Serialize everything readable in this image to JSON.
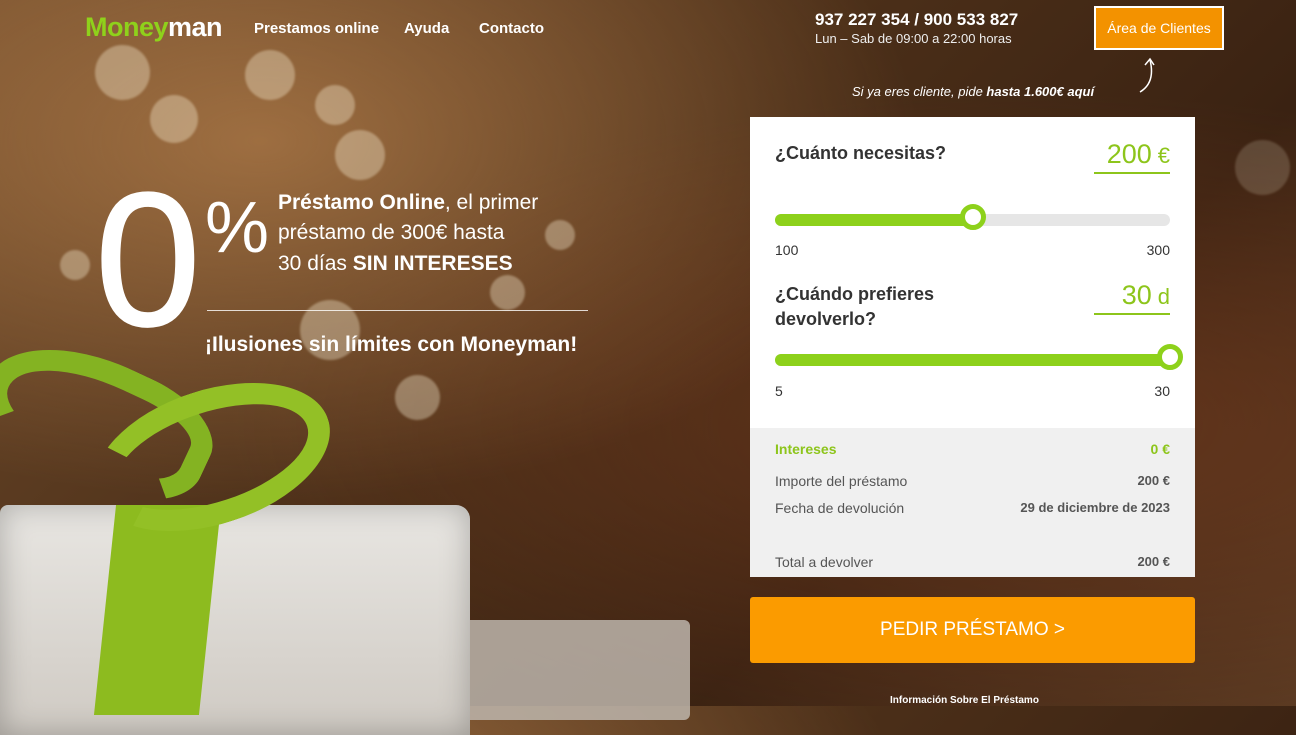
{
  "header": {
    "logo_part1": "Money",
    "logo_part2": "man",
    "nav": [
      "Prestamos online",
      "Ayuda",
      "Contacto"
    ],
    "phone": "937 227 354 / 900 533 827",
    "hours": "Lun – Sab de 09:00 a 22:00 horas",
    "client_area_button": "Área de Clientes",
    "client_hint_prefix": "Si ya eres cliente, pide ",
    "client_hint_bold": "hasta 1.600€ aquí"
  },
  "hero": {
    "zero": "0",
    "percent": "%",
    "line1_bold": "Préstamo Online",
    "line1_rest": ", el primer",
    "line2": "préstamo de 300€ hasta",
    "line3_prefix": "30 días ",
    "line3_bold": "SIN INTERESES",
    "tagline": "¡Ilusiones sin límites con Moneyman!"
  },
  "calculator": {
    "amount": {
      "question": "¿Cuánto necesitas?",
      "value": "200",
      "unit": "€",
      "min": "100",
      "max": "300",
      "fraction": 0.5
    },
    "days": {
      "question": "¿Cuándo prefieres devolverlo?",
      "value": "30",
      "unit": "d",
      "min": "5",
      "max": "30",
      "fraction": 1.0
    },
    "summary": {
      "interest_label": "Intereses",
      "interest_value": "0 €",
      "amount_label": "Importe del préstamo",
      "amount_value": "200 €",
      "date_label": "Fecha de devolución",
      "date_value": "29 de diciembre de 2023",
      "total_label": "Total a devolver",
      "total_value": "200 €"
    },
    "cta": "PEDIR PRÉSTAMO >",
    "info_link": "Información Sobre El Préstamo"
  },
  "colors": {
    "accent_green": "#8dd11b",
    "accent_orange": "#fb9b00"
  }
}
